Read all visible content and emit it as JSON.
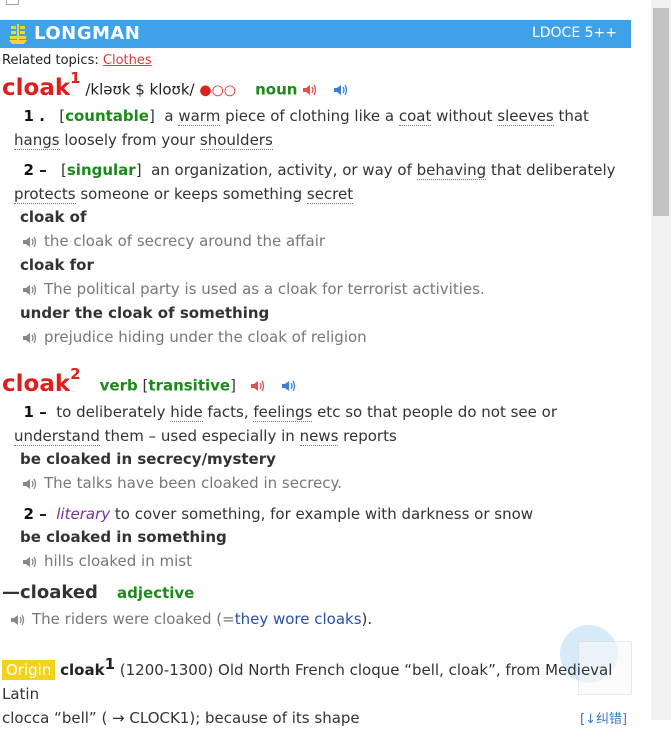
{
  "banner": {
    "brand": "LONGMAN",
    "edition": "LDOCE 5++"
  },
  "related": {
    "label": "Related topics:",
    "topic": "Clothes"
  },
  "entry1": {
    "word": "cloak",
    "hom": "1",
    "pron": "/kləʊk $ kloʊk/",
    "freq": "●○○",
    "pos": "noun",
    "senses": [
      {
        "num": "1 .",
        "gram": "countable"
      },
      {
        "num": "2 –",
        "gram": "singular"
      }
    ],
    "collocs": [
      "cloak of",
      "cloak for",
      "under the cloak of something"
    ],
    "examples": [
      "the cloak of secrecy around the affair",
      "The political party is used as a cloak for terrorist activities.",
      "prejudice hiding under the cloak of religion"
    ]
  },
  "entry2": {
    "word": "cloak",
    "hom": "2",
    "pos": "verb",
    "gram": "transitive",
    "s1_num": "1 –",
    "colloc1": "be cloaked in secrecy/mystery",
    "ex1": "The talks have been cloaked in secrecy.",
    "s2_num": "2 –",
    "s2_reg": "literary",
    "s2_def": "to cover something, for example with darkness or snow",
    "colloc2": "be cloaked in something",
    "ex2": "hills cloaked in mist"
  },
  "derived": {
    "dash": "—",
    "word": "cloaked",
    "pos": "adjective",
    "example_a": "The riders were cloaked (=",
    "example_b": "they wore cloaks",
    "example_c": ")."
  },
  "origin": {
    "tag": "Origin",
    "word": "cloak",
    "hom": "1",
    "line1": "(1200-1300) Old North French cloque “bell, cloak”, from Medieval Latin",
    "line2": "clocca “bell” ( → CLOCK1); because of its shape"
  },
  "corner": "[↓纠错]",
  "colors": {
    "banner": "#3fa2e8",
    "headword": "#e01e1e",
    "grammar": "#1a8a1a",
    "register": "#7b2fa0"
  }
}
